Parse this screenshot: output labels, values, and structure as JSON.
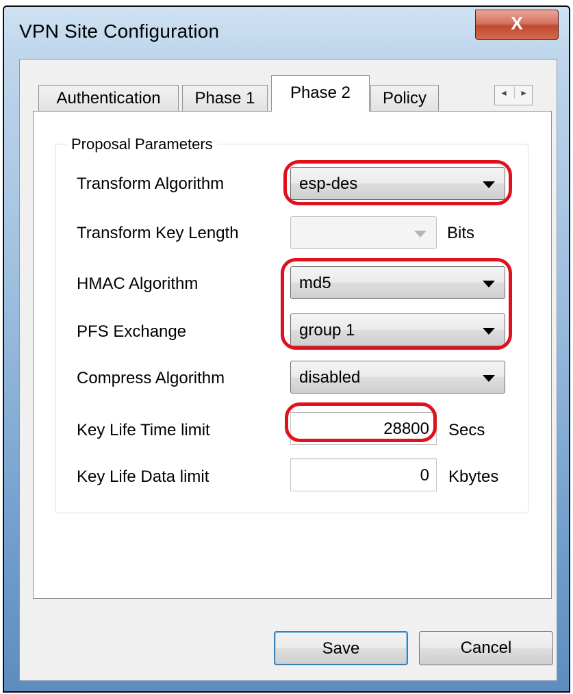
{
  "window": {
    "title": "VPN Site Configuration",
    "close_glyph": "X"
  },
  "tabs": [
    {
      "label": "Authentication",
      "active": false
    },
    {
      "label": "Phase 1",
      "active": false
    },
    {
      "label": "Phase 2",
      "active": true
    },
    {
      "label": "Policy",
      "active": false
    }
  ],
  "tab_scroll": {
    "left_glyph": "◂",
    "right_glyph": "▸"
  },
  "group": {
    "title": "Proposal Parameters"
  },
  "fields": {
    "transform_algorithm": {
      "label": "Transform Algorithm",
      "value": "esp-des"
    },
    "transform_key_length": {
      "label": "Transform Key Length",
      "value": "",
      "unit": "Bits"
    },
    "hmac_algorithm": {
      "label": "HMAC Algorithm",
      "value": "md5"
    },
    "pfs_exchange": {
      "label": "PFS Exchange",
      "value": "group 1"
    },
    "compress_algorithm": {
      "label": "Compress Algorithm",
      "value": "disabled"
    },
    "key_life_time_limit": {
      "label": "Key Life Time limit",
      "value": "28800",
      "unit": "Secs"
    },
    "key_life_data_limit": {
      "label": "Key Life Data limit",
      "value": "0",
      "unit": "Kbytes"
    }
  },
  "buttons": {
    "save": "Save",
    "cancel": "Cancel"
  },
  "colors": {
    "highlight": "#e0101c",
    "close_button": "#c04a30",
    "default_button_border": "#3c7fb1"
  }
}
